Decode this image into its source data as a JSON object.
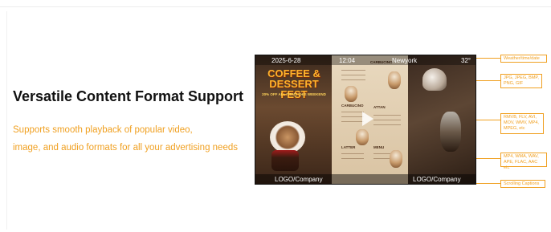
{
  "heading": "Versatile Content Format Support",
  "description_line1": "Supports smooth playback of popular video,",
  "description_line2": "image, and audio formats for all your advertising needs",
  "screen": {
    "date": "2025-6-28",
    "time": "12:04",
    "city": "Newyork",
    "temperature": "32°",
    "left_logo": "LOGO/Company",
    "right_logo": "LOGO/Company",
    "promo_title_line1": "COFFEE &",
    "promo_title_line2": "DESSERT FEST",
    "promo_subtitle": "20% OFF ALL ITEMS THIS WEEKEND",
    "menu_sections": [
      "CARBUCINO",
      "CARBUCINO",
      "ATTAN",
      "LATTER",
      "MENU"
    ]
  },
  "callouts": {
    "weather": "Weather/time/date",
    "images": "JPG, JPEG, BMP, PNG, GIF",
    "video": "RMVB, FLV, AVI, MOV, WMV, MP4, MPEG, etc",
    "audio": "MP4, WMA, WAV, APE, FLAC, AAC etc",
    "captions": "Scrolling Captions"
  },
  "colors": {
    "accent": "#f0a021",
    "heading": "#111111",
    "background": "#ffffff"
  }
}
